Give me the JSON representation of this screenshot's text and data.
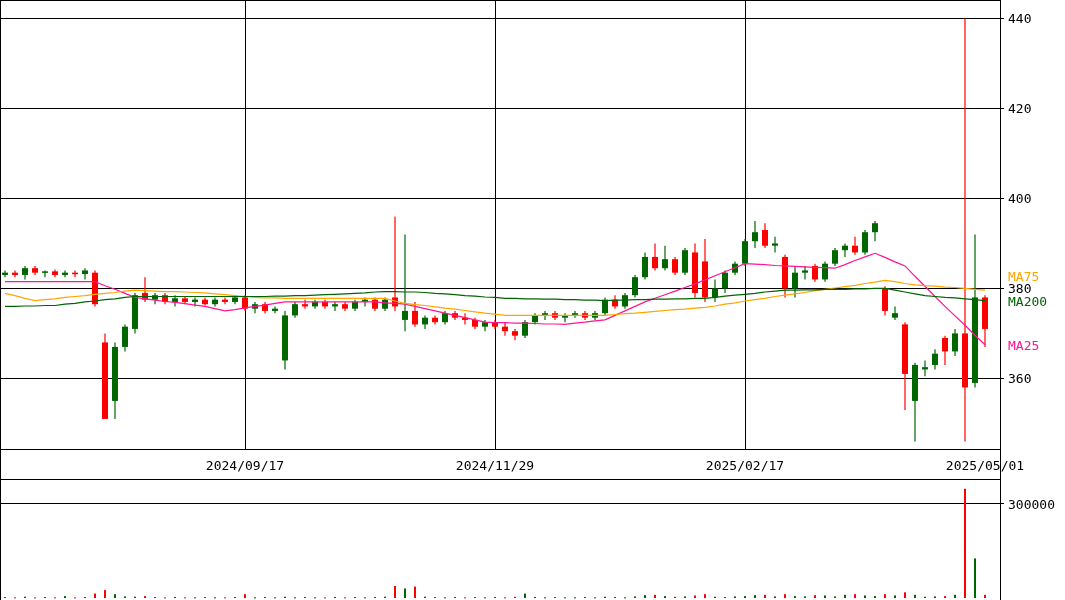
{
  "price_chart": {
    "chart_data": {
      "type": "candlestick",
      "grid": true,
      "ylim": [
        344.2,
        444
      ],
      "yticks": [
        360,
        380,
        400,
        420,
        440
      ],
      "categories": [
        null,
        null,
        null,
        null,
        null,
        null,
        null,
        null,
        null,
        null,
        null,
        null,
        null,
        null,
        null,
        null,
        null,
        null,
        null,
        null,
        null,
        null,
        null,
        null,
        "2024/09/17",
        null,
        null,
        null,
        null,
        null,
        null,
        null,
        null,
        null,
        null,
        null,
        null,
        null,
        null,
        null,
        null,
        null,
        null,
        null,
        null,
        null,
        null,
        null,
        null,
        "2024/11/29",
        null,
        null,
        null,
        null,
        null,
        null,
        null,
        null,
        null,
        null,
        null,
        null,
        null,
        null,
        null,
        null,
        null,
        null,
        null,
        null,
        null,
        null,
        null,
        null,
        "2025/02/17",
        null,
        null,
        null,
        null,
        null,
        null,
        null,
        null,
        null,
        null,
        null,
        null,
        null,
        null,
        null,
        null,
        null,
        null,
        null,
        null,
        null,
        null,
        null,
        "2025/05/01"
      ],
      "series": [
        {
          "name": "MA25",
          "type": "line",
          "color": "#ff1493",
          "values": [
            381.5,
            381.5,
            381.5,
            381.5,
            381.5,
            381.5,
            381.5,
            381.5,
            381.5,
            381.5,
            380.6,
            379.8,
            378.9,
            378,
            377.7,
            377.4,
            377.1,
            376.9,
            376.6,
            376.3,
            376,
            375.5,
            375,
            375.3,
            375.7,
            376,
            376.3,
            376.7,
            377,
            377,
            377,
            377,
            377,
            377,
            377,
            377,
            377,
            377,
            376.8,
            376.7,
            376.5,
            376,
            375.5,
            375,
            374.5,
            374,
            373.5,
            373,
            372.5,
            372.4,
            372.4,
            372.3,
            372.3,
            372.2,
            372.1,
            372.1,
            372,
            372.3,
            372.5,
            372.8,
            373,
            374,
            375,
            376,
            377,
            377.8,
            378.6,
            379.4,
            380.2,
            381,
            381.9,
            382.8,
            383.7,
            384.6,
            385.5,
            385.4,
            385.3,
            385.1,
            385,
            384.9,
            384.8,
            384.7,
            384.6,
            384.5,
            385.3,
            386.2,
            387,
            387.8,
            386.9,
            385.9,
            385,
            382.7,
            380.5,
            378.2,
            376,
            373.9,
            371.8,
            369.6,
            367.5
          ]
        },
        {
          "name": "MA75",
          "type": "line",
          "color": "#ffa500",
          "values": [
            378.9,
            378.4,
            377.8,
            377.3,
            377.5,
            377.7,
            378,
            378.2,
            378.4,
            378.7,
            378.9,
            379.1,
            379.4,
            379.6,
            379.5,
            379.4,
            379.3,
            379.3,
            379.2,
            379.1,
            379,
            378.8,
            378.6,
            378.4,
            378.2,
            378,
            377.9,
            377.9,
            377.8,
            377.8,
            377.8,
            377.8,
            377.8,
            377.8,
            377.8,
            377.8,
            377.8,
            377.8,
            377.8,
            377.2,
            376.7,
            376.4,
            376.2,
            375.9,
            375.6,
            375.4,
            375.1,
            374.8,
            374.5,
            374.3,
            374,
            374,
            374,
            374,
            374,
            374,
            374,
            374,
            374,
            374,
            374,
            374.2,
            374.4,
            374.5,
            374.7,
            374.9,
            375.1,
            375.3,
            375.4,
            375.6,
            375.8,
            376.1,
            376.5,
            376.8,
            377.2,
            377.5,
            377.8,
            378.2,
            378.5,
            378.8,
            379.1,
            379.5,
            379.8,
            380.1,
            380.4,
            380.7,
            381.1,
            381.4,
            381.8,
            381.5,
            381.1,
            380.8,
            380.6,
            380.5,
            380.3,
            380.2,
            380,
            379.8,
            379.6
          ]
        },
        {
          "name": "MA200",
          "type": "line",
          "color": "#006400",
          "values": [
            376,
            376,
            376.1,
            376.1,
            376.2,
            376.2,
            376.5,
            376.7,
            377,
            377.2,
            377.5,
            377.7,
            378,
            378.2,
            378.2,
            378.2,
            378.2,
            378.2,
            378.2,
            378.2,
            378.2,
            378.2,
            378.2,
            378.2,
            378.2,
            378.2,
            378.2,
            378.3,
            378.3,
            378.4,
            378.4,
            378.5,
            378.6,
            378.7,
            378.8,
            378.9,
            379,
            379.2,
            379.3,
            379.3,
            379.2,
            379.2,
            379.1,
            378.9,
            378.8,
            378.6,
            378.4,
            378.3,
            378.1,
            378,
            377.8,
            377.8,
            377.7,
            377.7,
            377.6,
            377.6,
            377.5,
            377.5,
            377.4,
            377.4,
            377.3,
            377.4,
            377.4,
            377.5,
            377.5,
            377.6,
            377.6,
            377.7,
            377.7,
            377.8,
            377.8,
            378,
            378.3,
            378.5,
            378.7,
            378.9,
            379.2,
            379.4,
            379.6,
            379.6,
            379.7,
            379.7,
            379.8,
            379.8,
            379.8,
            379.9,
            379.9,
            380,
            380,
            379.6,
            379.2,
            378.8,
            378.4,
            378.2,
            378,
            377.9,
            377.7,
            377.5,
            377.3
          ]
        }
      ],
      "ohlc": [
        [
          383,
          384,
          382.5,
          383.5
        ],
        [
          383.5,
          384,
          382.5,
          383
        ],
        [
          383,
          385,
          382,
          384.5
        ],
        [
          384.5,
          385,
          383,
          383.5
        ],
        [
          383.5,
          384,
          382.5,
          383.8
        ],
        [
          383.8,
          384.2,
          382.5,
          383
        ],
        [
          383,
          384,
          382.5,
          383.5
        ],
        [
          383.5,
          384,
          382.5,
          383.2
        ],
        [
          383.2,
          384.5,
          382,
          384
        ],
        [
          383.5,
          384,
          376,
          376.5
        ],
        [
          368,
          370,
          351,
          351
        ],
        [
          355,
          368,
          351,
          367
        ],
        [
          367,
          372,
          366,
          371.5
        ],
        [
          371,
          379,
          370,
          378.5
        ],
        [
          379,
          382.5,
          377,
          377.5
        ],
        [
          377.5,
          379,
          376.5,
          378.5
        ],
        [
          378.5,
          379,
          376.5,
          377
        ],
        [
          377,
          378.5,
          376,
          377.8
        ],
        [
          377.8,
          378.2,
          376.5,
          377
        ],
        [
          377,
          378,
          376,
          377.5
        ],
        [
          377.5,
          378,
          376.2,
          376.5
        ],
        [
          376.5,
          378,
          376,
          377.5
        ],
        [
          377.5,
          378,
          376.5,
          377
        ],
        [
          377,
          378.5,
          376.5,
          378
        ],
        [
          378,
          378.5,
          375,
          375.5
        ],
        [
          375.5,
          377,
          374.5,
          376.5
        ],
        [
          376.5,
          377,
          374.5,
          375
        ],
        [
          375,
          376,
          374.5,
          375.5
        ],
        [
          364,
          375,
          362,
          374
        ],
        [
          374,
          377,
          373.5,
          376.5
        ],
        [
          376.5,
          377.5,
          375.5,
          376
        ],
        [
          376,
          377.5,
          375.5,
          377
        ],
        [
          377,
          377.5,
          375.5,
          376
        ],
        [
          376,
          377,
          375,
          376.5
        ],
        [
          376.5,
          377,
          375,
          375.5
        ],
        [
          375.5,
          377.5,
          375,
          377
        ],
        [
          377,
          378,
          376,
          377.5
        ],
        [
          377.5,
          378,
          375,
          375.5
        ],
        [
          375.5,
          378,
          375,
          377.5
        ],
        [
          378,
          396,
          375,
          376
        ],
        [
          373,
          392,
          370.5,
          375
        ],
        [
          375,
          377,
          371.5,
          372
        ],
        [
          372,
          374,
          371,
          373.5
        ],
        [
          373.5,
          374,
          372,
          372.5
        ],
        [
          372.5,
          375,
          372,
          374.5
        ],
        [
          374.5,
          375,
          373,
          373.5
        ],
        [
          373.5,
          374.5,
          372,
          373
        ],
        [
          373,
          373.5,
          371,
          371.5
        ],
        [
          371.5,
          373,
          370.5,
          372.5
        ],
        [
          372.5,
          373,
          371,
          371.5
        ],
        [
          371.5,
          372.5,
          369.5,
          370.5
        ],
        [
          370.5,
          371,
          368.5,
          369.5
        ],
        [
          369.5,
          373,
          369,
          372.5
        ],
        [
          372.5,
          374.5,
          372,
          374
        ],
        [
          374,
          375,
          373,
          374.5
        ],
        [
          374.5,
          375,
          373,
          373.5
        ],
        [
          373.5,
          374.5,
          372.5,
          374
        ],
        [
          374,
          375,
          373.5,
          374.5
        ],
        [
          374.5,
          375,
          373,
          373.5
        ],
        [
          373.5,
          375,
          373,
          374.5
        ],
        [
          374.5,
          378,
          374,
          377.5
        ],
        [
          377.5,
          378.5,
          375.5,
          376
        ],
        [
          376,
          379,
          375.5,
          378.5
        ],
        [
          378.5,
          383,
          378,
          382.5
        ],
        [
          382.5,
          388,
          382,
          387
        ],
        [
          387,
          390,
          384,
          384.5
        ],
        [
          384.5,
          389.5,
          384,
          386.5
        ],
        [
          386.5,
          387,
          383,
          383.5
        ],
        [
          383.5,
          389,
          383,
          388.5
        ],
        [
          388,
          390,
          378,
          379
        ],
        [
          386,
          391,
          377,
          378
        ],
        [
          378,
          382,
          377,
          380
        ],
        [
          380,
          384,
          379,
          383.5
        ],
        [
          383.5,
          386,
          383,
          385.5
        ],
        [
          385.5,
          391,
          385,
          390.5
        ],
        [
          390.5,
          395,
          389,
          392.5
        ],
        [
          393,
          394.5,
          389,
          389.5
        ],
        [
          389.5,
          391.5,
          388,
          390
        ],
        [
          387,
          387.5,
          378,
          380
        ],
        [
          380,
          385,
          378,
          383.5
        ],
        [
          383.5,
          385,
          382,
          384
        ],
        [
          385,
          385.5,
          381.5,
          382
        ],
        [
          382,
          386,
          381.5,
          385.5
        ],
        [
          385.5,
          389,
          385,
          388.5
        ],
        [
          388.5,
          390,
          387,
          389.5
        ],
        [
          389.5,
          391.5,
          387.5,
          388
        ],
        [
          388,
          393,
          387.5,
          392.5
        ],
        [
          392.5,
          395,
          390.5,
          394.5
        ],
        [
          380,
          380.5,
          374,
          375
        ],
        [
          373.5,
          376,
          373,
          374.5
        ],
        [
          372,
          372.5,
          353,
          361
        ],
        [
          355,
          363.5,
          346,
          363
        ],
        [
          362,
          364,
          360.5,
          362.5
        ],
        [
          363,
          366.5,
          362,
          365.5
        ],
        [
          369,
          369.5,
          363,
          366
        ],
        [
          366,
          371,
          365,
          370
        ],
        [
          370,
          440,
          346,
          358
        ],
        [
          359,
          392,
          358,
          378
        ],
        [
          378,
          378.5,
          367,
          371
        ]
      ]
    }
  },
  "volume_chart": {
    "chart_data": {
      "type": "bar",
      "grid": true,
      "ylim": [
        0,
        372600
      ],
      "yticks": [
        300000
      ],
      "series": [
        {
          "values": [
            3000,
            2000,
            4000,
            2000,
            3000,
            2000,
            6000,
            2000,
            3000,
            14000,
            25000,
            12000,
            5000,
            4000,
            6000,
            3000,
            2000,
            3000,
            2000,
            2000,
            3000,
            2000,
            2000,
            3000,
            12000,
            2000,
            3000,
            2000,
            4000,
            2000,
            3000,
            2000,
            2000,
            3000,
            2000,
            3000,
            2000,
            3000,
            4000,
            38000,
            30000,
            36000,
            4000,
            3000,
            2000,
            3000,
            2000,
            3000,
            2000,
            3000,
            2000,
            4000,
            14000,
            3000,
            2000,
            3000,
            2000,
            2000,
            3000,
            2000,
            4000,
            3000,
            2000,
            5000,
            9000,
            10000,
            6000,
            4000,
            5000,
            8000,
            12000,
            4000,
            3000,
            5000,
            6000,
            9000,
            10000,
            5000,
            12000,
            6000,
            5000,
            9000,
            8000,
            5000,
            10000,
            12000,
            8000,
            6000,
            12000,
            8000,
            18000,
            10000,
            4000,
            5000,
            6000,
            10000,
            345000,
            125000,
            10000
          ]
        }
      ]
    }
  }
}
